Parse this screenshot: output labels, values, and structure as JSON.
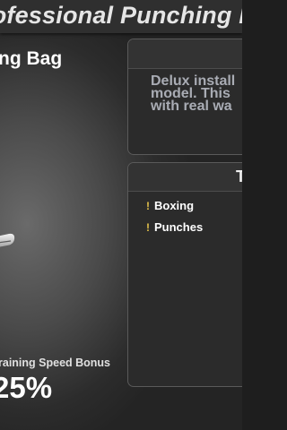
{
  "header": {
    "title": "rofessional Punching B"
  },
  "item": {
    "name": "ng Bag"
  },
  "description": {
    "lines": [
      "Delux install",
      "model. This ",
      "with real wa"
    ]
  },
  "tags_panel": {
    "header": "T",
    "tags": [
      {
        "label": "Boxing",
        "icon": "exclamation-icon"
      },
      {
        "label": "Punches",
        "icon": "exclamation-icon"
      }
    ]
  },
  "bonus": {
    "label": "raining Speed Bonus",
    "value": "25%"
  },
  "colors": {
    "description_text": "#a9acb4",
    "tag_icon": "#e2c04a",
    "panel_border": "#5a5a5a"
  }
}
